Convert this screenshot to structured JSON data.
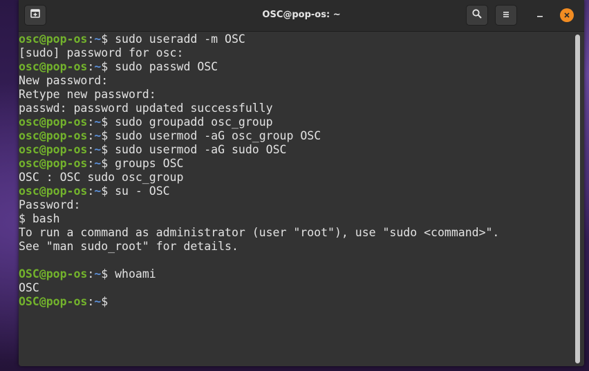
{
  "window": {
    "title": "OSC@pop-os: ~"
  },
  "icons": {
    "new_tab": "new-tab-icon",
    "search": "search-icon",
    "menu": "hamburger-menu-icon",
    "minimize": "minimize-icon",
    "close": "close-icon"
  },
  "colors": {
    "prompt_user": "#73b32c",
    "prompt_path": "#5b8ed6",
    "terminal_bg": "#333333",
    "close_button": "#f28c22"
  },
  "prompt": {
    "user": "OSC",
    "at": "@",
    "host": "pop-os",
    "colon": ":",
    "path": "~",
    "symbol": "$ "
  },
  "lines": [
    {
      "kind": "cmd",
      "user": "osc",
      "host": "pop-os",
      "text": "sudo useradd -m OSC"
    },
    {
      "kind": "out",
      "text": "[sudo] password for osc:"
    },
    {
      "kind": "cmd",
      "user": "osc",
      "host": "pop-os",
      "text": "sudo passwd OSC"
    },
    {
      "kind": "out",
      "text": "New password:"
    },
    {
      "kind": "out",
      "text": "Retype new password:"
    },
    {
      "kind": "out",
      "text": "passwd: password updated successfully"
    },
    {
      "kind": "cmd",
      "user": "osc",
      "host": "pop-os",
      "text": "sudo groupadd osc_group"
    },
    {
      "kind": "cmd",
      "user": "osc",
      "host": "pop-os",
      "text": "sudo usermod -aG osc_group OSC"
    },
    {
      "kind": "cmd",
      "user": "osc",
      "host": "pop-os",
      "text": "sudo usermod -aG sudo OSC"
    },
    {
      "kind": "cmd",
      "user": "osc",
      "host": "pop-os",
      "text": "groups OSC"
    },
    {
      "kind": "out",
      "text": "OSC : OSC sudo osc_group"
    },
    {
      "kind": "cmd",
      "user": "osc",
      "host": "pop-os",
      "text": "su - OSC"
    },
    {
      "kind": "out",
      "text": "Password:"
    },
    {
      "kind": "out",
      "text": "$ bash"
    },
    {
      "kind": "out",
      "text": "To run a command as administrator (user \"root\"), use \"sudo <command>\"."
    },
    {
      "kind": "out",
      "text": "See \"man sudo_root\" for details."
    },
    {
      "kind": "out",
      "text": ""
    },
    {
      "kind": "cmd",
      "user": "OSC",
      "host": "pop-os",
      "text": "whoami"
    },
    {
      "kind": "out",
      "text": "OSC"
    },
    {
      "kind": "cmd",
      "user": "OSC",
      "host": "pop-os",
      "text": ""
    }
  ]
}
